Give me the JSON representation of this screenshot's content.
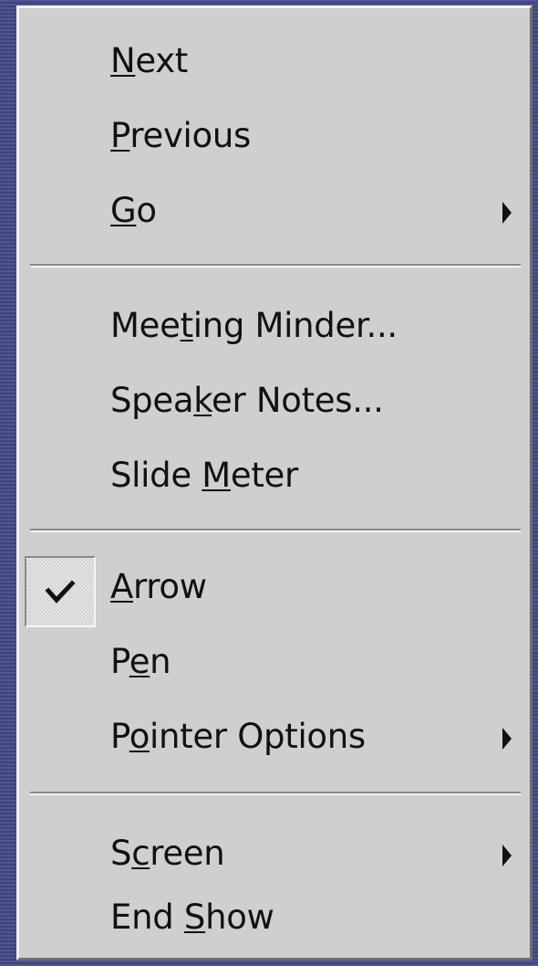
{
  "menu": {
    "items": [
      {
        "pre": "",
        "u": "N",
        "post": "ext",
        "submenu": false,
        "checked": false
      },
      {
        "pre": "",
        "u": "P",
        "post": "revious",
        "submenu": false,
        "checked": false
      },
      {
        "pre": "",
        "u": "G",
        "post": "o",
        "submenu": true,
        "checked": false
      },
      {
        "pre": "Mee",
        "u": "t",
        "post": "ing Minder...",
        "submenu": false,
        "checked": false
      },
      {
        "pre": "Spea",
        "u": "k",
        "post": "er Notes...",
        "submenu": false,
        "checked": false
      },
      {
        "pre": "Slide ",
        "u": "M",
        "post": "eter",
        "submenu": false,
        "checked": false
      },
      {
        "pre": "",
        "u": "A",
        "post": "rrow",
        "submenu": false,
        "checked": true
      },
      {
        "pre": "P",
        "u": "e",
        "post": "n",
        "submenu": false,
        "checked": false
      },
      {
        "pre": "P",
        "u": "o",
        "post": "inter Options",
        "submenu": true,
        "checked": false
      },
      {
        "pre": "S",
        "u": "c",
        "post": "reen",
        "submenu": true,
        "checked": false
      },
      {
        "pre": "End ",
        "u": "S",
        "post": "how",
        "submenu": false,
        "checked": false
      }
    ],
    "icons": {
      "check": "checkmark-icon",
      "submenu": "submenu-arrow-icon"
    }
  }
}
